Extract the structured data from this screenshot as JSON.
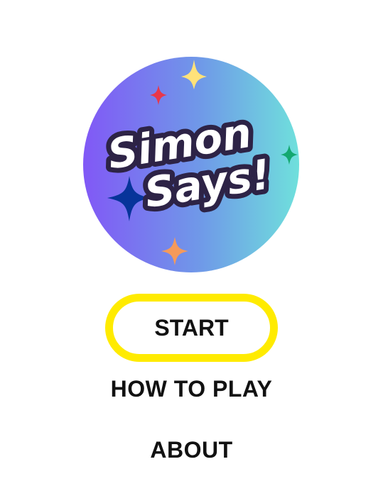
{
  "logo": {
    "line1": "Simon",
    "line2": "Says!",
    "gradient_start": "#7f5cf5",
    "gradient_end": "#6fd8dc",
    "icon": "simon-says-logo-icon"
  },
  "menu": {
    "start_label": "START",
    "how_to_play_label": "HOW TO PLAY",
    "about_label": "ABOUT",
    "highlight_color": "#ffeb00"
  }
}
